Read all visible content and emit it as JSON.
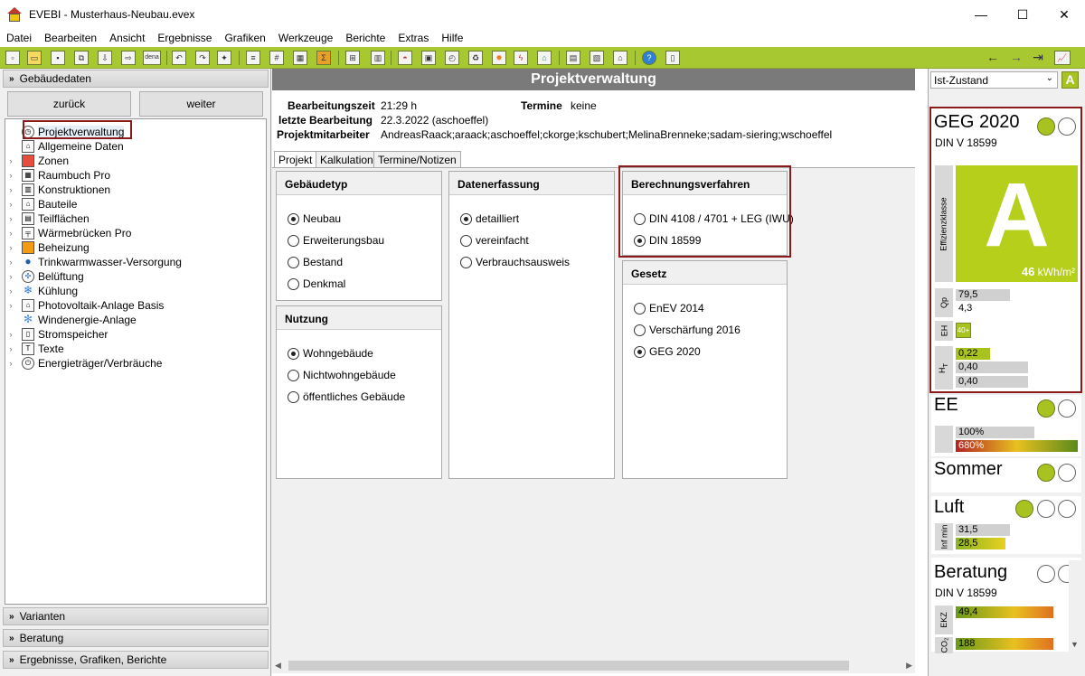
{
  "window": {
    "app": "EVEBI",
    "title": "EVEBI  -  Musterhaus-Neubau.evex",
    "min": "—",
    "max": "☐",
    "close": "✕"
  },
  "menu": [
    "Datei",
    "Bearbeiten",
    "Ansicht",
    "Ergebnisse",
    "Grafiken",
    "Werkzeuge",
    "Berichte",
    "Extras",
    "Hilfe"
  ],
  "left": {
    "section_top": "Gebäudedaten",
    "back": "zurück",
    "next": "weiter",
    "tree": [
      {
        "label": "Projektverwaltung",
        "icon": "stopwatch-icon",
        "exp": ""
      },
      {
        "label": "Allgemeine Daten",
        "icon": "house-icon",
        "exp": ""
      },
      {
        "label": "Zonen",
        "icon": "zones-icon",
        "exp": "›"
      },
      {
        "label": "Raumbuch Pro",
        "icon": "grid-icon",
        "exp": "›"
      },
      {
        "label": "Konstruktionen",
        "icon": "layers-icon",
        "exp": "›"
      },
      {
        "label": "Bauteile",
        "icon": "house-outline-icon",
        "exp": "›"
      },
      {
        "label": "Teilflächen",
        "icon": "surfaces-icon",
        "exp": "›"
      },
      {
        "label": "Wärmebrücken Pro",
        "icon": "bridge-icon",
        "exp": "›"
      },
      {
        "label": "Beheizung",
        "icon": "flame-icon",
        "exp": "›"
      },
      {
        "label": "Trinkwarmwasser-Versorgung",
        "icon": "drop-icon",
        "exp": "›"
      },
      {
        "label": "Belüftung",
        "icon": "fan-icon",
        "exp": "›"
      },
      {
        "label": "Kühlung",
        "icon": "snowflake-icon",
        "exp": "›"
      },
      {
        "label": "Photovoltaik-Anlage Basis",
        "icon": "solar-icon",
        "exp": "›"
      },
      {
        "label": "Windenergie-Anlage",
        "icon": "wind-icon",
        "exp": ""
      },
      {
        "label": "Stromspeicher",
        "icon": "battery-icon",
        "exp": "›"
      },
      {
        "label": "Texte",
        "icon": "text-icon",
        "exp": "›"
      },
      {
        "label": "Energieträger/Verbräuche",
        "icon": "plug-icon",
        "exp": "›"
      }
    ],
    "sections_bottom": [
      "Varianten",
      "Beratung",
      "Ergebnisse, Grafiken, Berichte"
    ]
  },
  "center": {
    "title": "Projektverwaltung",
    "bearbeitungszeit_label": "Bearbeitungszeit",
    "bearbeitungszeit": "21:29 h",
    "termine_label": "Termine",
    "termine": "keine",
    "letzte_label": "letzte Bearbeitung",
    "letzte": "22.3.2022 (aschoeffel)",
    "mitarbeiter_label": "Projektmitarbeiter",
    "mitarbeiter": "AndreasRaack;araack;aschoeffel;ckorge;kschubert;MelinaBrenneke;sadam-siering;wschoeffel",
    "tabs": [
      "Projekt",
      "Kalkulation",
      "Termine/Notizen"
    ],
    "gebaeudetyp": {
      "title": "Gebäudetyp",
      "options": [
        "Neubau",
        "Erweiterungsbau",
        "Bestand",
        "Denkmal"
      ],
      "selected": 0
    },
    "nutzung": {
      "title": "Nutzung",
      "options": [
        "Wohngebäude",
        "Nichtwohngebäude",
        "öffentliches Gebäude"
      ],
      "selected": 0
    },
    "datenerfassung": {
      "title": "Datenerfassung",
      "options": [
        "detailliert",
        "vereinfacht",
        "Verbrauchsausweis"
      ],
      "selected": 0
    },
    "verfahren": {
      "title": "Berechnungsverfahren",
      "options": [
        "DIN 4108 / 4701 + LEG (IWU)",
        "DIN 18599"
      ],
      "selected": 1
    },
    "gesetz": {
      "title": "Gesetz",
      "options": [
        "EnEV 2014",
        "Verschärfung 2016",
        "GEG 2020"
      ],
      "selected": 2
    }
  },
  "right": {
    "state": "Ist-Zustand",
    "state_badge": "A",
    "geg": {
      "title": "GEG 2020",
      "sub": "DIN V 18599",
      "effizienz": "Effizienzklasse",
      "klasse": "A",
      "value": "46",
      "unit": "kWh/m²",
      "qp_label": "Qp",
      "qp1": "79,5",
      "qp2": "4,3",
      "eh_label": "EH",
      "eh": "40+",
      "ht_label": "H",
      "ht_sub": "T",
      "ht1": "0,22",
      "ht2": "0,40",
      "ht3": "0,40"
    },
    "ee": {
      "title": "EE",
      "b1": "100%",
      "b2": "680%"
    },
    "sommer": {
      "title": "Sommer"
    },
    "luft": {
      "title": "Luft",
      "label": "Inf min",
      "b1": "31,5",
      "b2": "28,5"
    },
    "beratung": {
      "title": "Beratung",
      "sub": "DIN V 18599",
      "ekz_label": "EKZ",
      "ekz": "49,4",
      "co2_label": "CO₂",
      "co2": "188"
    }
  }
}
